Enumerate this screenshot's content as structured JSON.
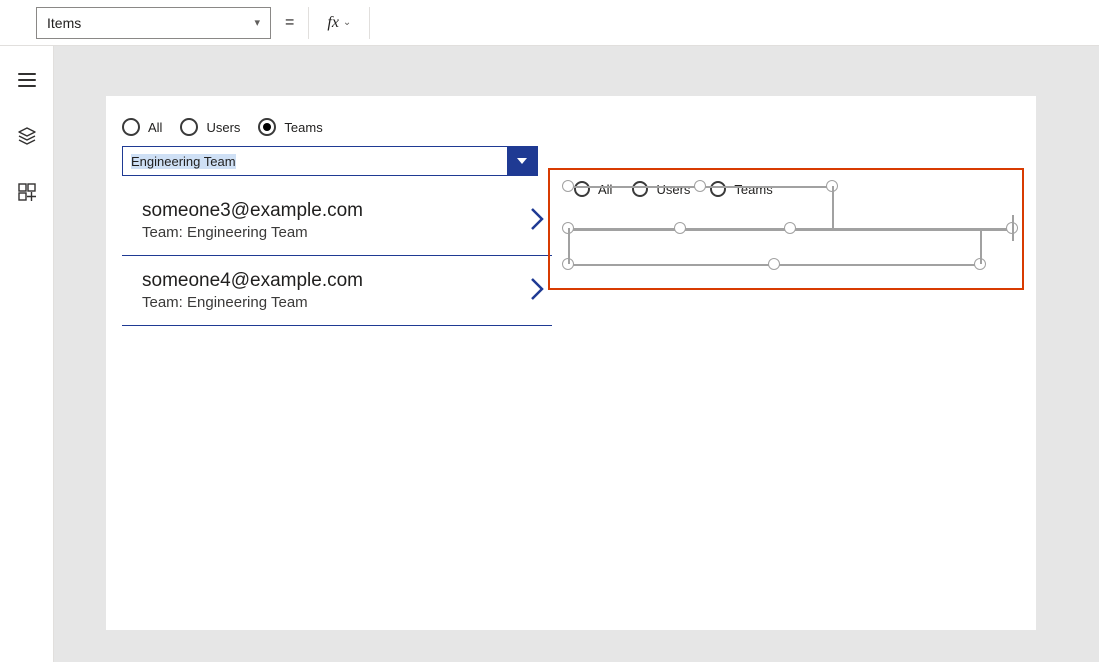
{
  "formula_bar": {
    "property": "Items",
    "equals": "=",
    "fx": "fx"
  },
  "screen1": {
    "radios": {
      "all": "All",
      "users": "Users",
      "teams": "Teams",
      "selected": "teams"
    },
    "dropdown": {
      "value": "Engineering Team"
    },
    "list": [
      {
        "title": "someone3@example.com",
        "sub": "Team: Engineering Team"
      },
      {
        "title": "someone4@example.com",
        "sub": "Team: Engineering Team"
      }
    ]
  },
  "screen2": {
    "radios": {
      "all": "All",
      "users": "Users",
      "teams": "Teams"
    }
  }
}
